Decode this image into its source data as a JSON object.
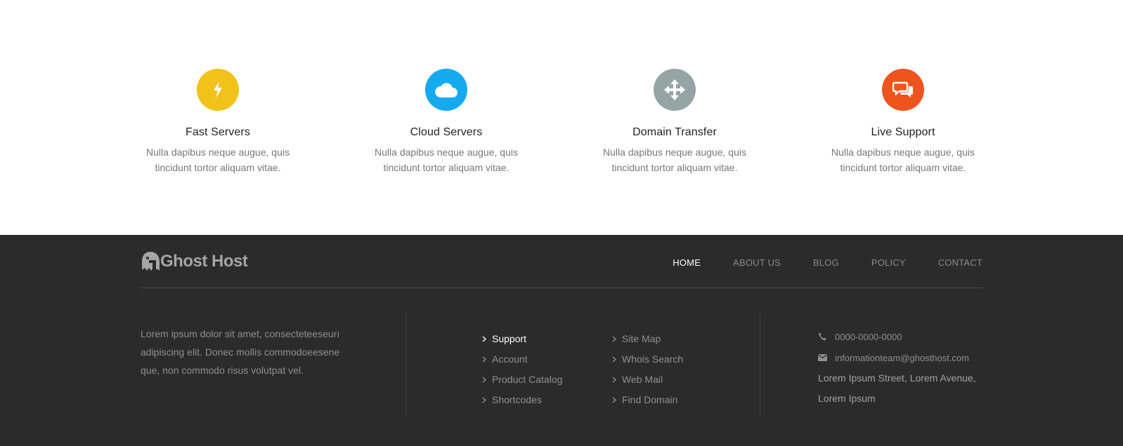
{
  "features": [
    {
      "title": "Fast Servers",
      "text": "Nulla dapibus neque augue, quis tincidunt tortor aliquam vitae.",
      "icon": "bolt-icon",
      "color": "#f2c21b"
    },
    {
      "title": "Cloud Servers",
      "text": "Nulla dapibus neque augue, quis tincidunt tortor aliquam vitae.",
      "icon": "cloud-icon",
      "color": "#15aaee"
    },
    {
      "title": "Domain Transfer",
      "text": "Nulla dapibus neque augue, quis tincidunt tortor aliquam vitae.",
      "icon": "move-arrows-icon",
      "color": "#95a5a6"
    },
    {
      "title": "Live Support",
      "text": "Nulla dapibus neque augue, quis tincidunt tortor aliquam vitae.",
      "icon": "chat-bubbles-icon",
      "color": "#f0541e"
    }
  ],
  "footer": {
    "logo_text": "Ghost Host",
    "nav": [
      {
        "label": "HOME",
        "active": true
      },
      {
        "label": "ABOUT US",
        "active": false
      },
      {
        "label": "BLOG",
        "active": false
      },
      {
        "label": "POLICY",
        "active": false
      },
      {
        "label": "CONTACT",
        "active": false
      }
    ],
    "about_text": "Lorem ipsum dolor sit amet, consecteteeseurı adipiscing elit. Donec mollis commodoeesene que, non commodo risus volutpat vel.",
    "links_col1": [
      "Support",
      "Account",
      "Product Catalog",
      "Shortcodes"
    ],
    "links_col2": [
      "Site Map",
      "Whois Search",
      "Web Mail",
      "Find Domain"
    ],
    "contact": {
      "phone": "0000-0000-0000",
      "email": "informationteam@ghosthost.com",
      "address": "Lorem Ipsum Street, Lorem Avenue, Lorem Ipsum"
    }
  }
}
